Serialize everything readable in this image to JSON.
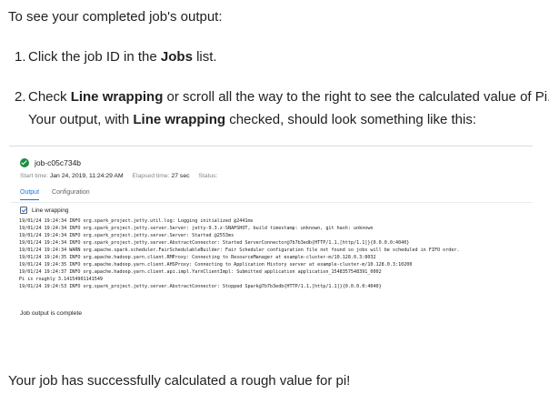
{
  "intro": "To see your completed job's output:",
  "steps": [
    {
      "num": "1.",
      "pre": "Click the job ID in the ",
      "bold": "Jobs",
      "post": " list."
    },
    {
      "num": "2.",
      "pre": "Check ",
      "bold": "Line wrapping",
      "post": " or scroll all the way to the right to see the calculated value of Pi.",
      "line2_pre": "Your output, with ",
      "line2_bold": "Line wrapping",
      "line2_post": " checked, should look something like this:"
    }
  ],
  "panel": {
    "job_id": "job-c05c734b",
    "start_label": "Start time:",
    "start_value": "Jan 24, 2019, 11:24:29 AM",
    "elapsed_label": "Elapsed time:",
    "elapsed_value": "27 sec",
    "status_label": "Status:",
    "tabs": [
      "Output",
      "Configuration"
    ],
    "line_wrapping": "Line wrapping",
    "log": [
      "19/01/24 19:24:34 INFO org.spark_project.jetty.util.log: Logging initialized @2441ms",
      "19/01/24 19:24:34 INFO org.spark_project.jetty.server.Server: jetty-9.3.z-SNAPSHOT, build timestamp: unknown, git hash: unknown",
      "19/01/24 19:24:34 INFO org.spark_project.jetty.server.Server: Started @2553ms",
      "19/01/24 19:24:34 INFO org.spark_project.jetty.server.AbstractConnector: Started ServerConnector@7b7b3edb{HTTP/1.1,[http/1.1]}{0.0.0.0:4040}",
      "19/01/24 19:24:34 WARN org.apache.spark.scheduler.FairSchedulableBuilder: Fair Scheduler configuration file not found so jobs will be scheduled in FIFO order.",
      "19/01/24 19:24:35 INFO org.apache.hadoop.yarn.client.RMProxy: Connecting to ResourceManager at example-cluster-m/10.128.0.3:8032",
      "19/01/24 19:24:35 INFO org.apache.hadoop.yarn.client.AHSProxy: Connecting to Application History server at example-cluster-m/10.128.0.3:10200",
      "19/01/24 19:24:37 INFO org.apache.hadoop.yarn.client.api.impl.YarnClientImpl: Submitted application application_1548357548391_0002",
      "Pi is roughly 3.14154901141549",
      "19/01/24 19:24:53 INFO org.spark_project.jetty.server.AbstractConnector: Stopped Spark@7b7b3edb{HTTP/1.1,[http/1.1]}{0.0.0.0:4040}"
    ],
    "complete": "Job output is complete"
  },
  "outro": "Your job has successfully calculated a rough value for pi!"
}
